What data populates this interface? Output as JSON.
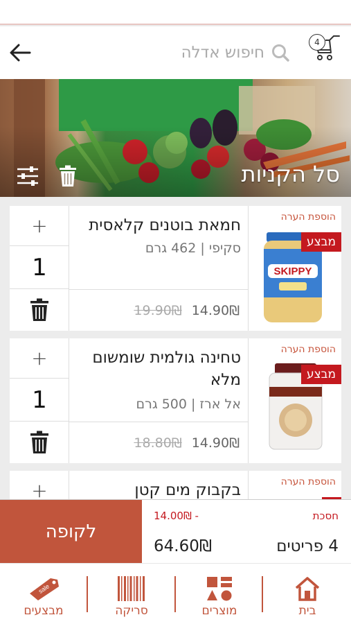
{
  "header": {
    "cart_count": "4",
    "search_placeholder": "חיפוש אדלה"
  },
  "hero": {
    "title": "סל הקניות"
  },
  "items": [
    {
      "name": "חמאת בוטנים קלאסית",
      "subtitle": "סקיפי | 462 גרם",
      "price": "14.90₪",
      "old_price": "19.90₪",
      "qty": "1",
      "plus": "+",
      "note": "הוספת הערה",
      "promo": "מבצע"
    },
    {
      "name": "טחינה גולמית שומשום מלא",
      "subtitle": "אל ארז | 500 גרם",
      "price": "14.90₪",
      "old_price": "18.80₪",
      "qty": "1",
      "plus": "+",
      "note": "הוספת הערה",
      "promo": "מבצע"
    },
    {
      "name": "בקבוק מים קטן",
      "plus": "+",
      "note": "הוספת הערה"
    }
  ],
  "summary": {
    "checkout_label": "לקופה",
    "savings_label": "חסכת",
    "savings_value": "14.00₪ -",
    "items_label": "4 פריטים",
    "total_value": "64.60₪"
  },
  "nav": [
    {
      "label": "בית",
      "icon": "home-icon"
    },
    {
      "label": "מוצרים",
      "icon": "products-icon"
    },
    {
      "label": "סריקה",
      "icon": "barcode-icon"
    },
    {
      "label": "מבצעים",
      "icon": "sale-tag-icon",
      "icon_text": "sale"
    }
  ],
  "colors": {
    "accent": "#c1553c",
    "promo": "#c4191f"
  }
}
